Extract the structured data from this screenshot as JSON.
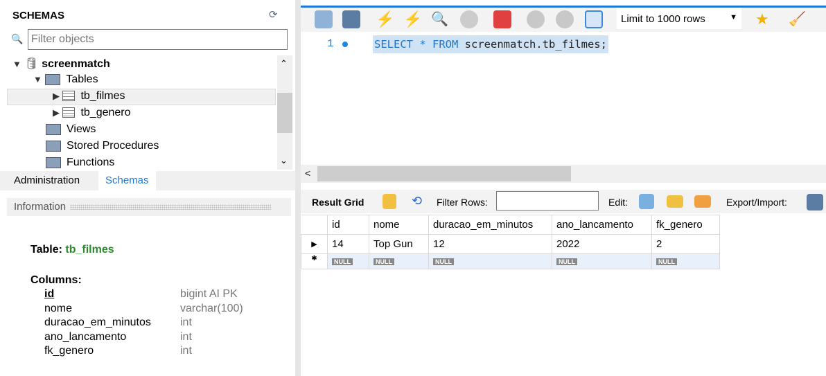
{
  "schemas": {
    "title": "SCHEMAS",
    "filter_placeholder": "Filter objects",
    "tree": {
      "schema": "screenmatch",
      "tables_label": "Tables",
      "tables": [
        "tb_filmes",
        "tb_genero"
      ],
      "views": "Views",
      "procedures": "Stored Procedures",
      "functions": "Functions"
    }
  },
  "tabs": [
    "Administration",
    "Schemas"
  ],
  "information": {
    "header": "Information",
    "table_label": "Table:",
    "table_name": "tb_filmes",
    "columns_label": "Columns:",
    "columns": [
      {
        "name": "id",
        "type": "bigint AI PK"
      },
      {
        "name": "nome",
        "type": "varchar(100)"
      },
      {
        "name": "duracao_em_minutos",
        "type": "int"
      },
      {
        "name": "ano_lancamento",
        "type": "int"
      },
      {
        "name": "fk_genero",
        "type": "int"
      }
    ]
  },
  "editor": {
    "limit": "Limit to 1000 rows",
    "line": "1",
    "sql_kw1": "SELECT",
    "sql_mid": " * ",
    "sql_kw2": "FROM",
    "sql_rest": " screenmatch.tb_filmes;"
  },
  "result": {
    "result_grid": "Result Grid",
    "filter_rows": "Filter Rows:",
    "edit": "Edit:",
    "export": "Export/Import:",
    "columns": [
      "id",
      "nome",
      "duracao_em_minutos",
      "ano_lancamento",
      "fk_genero"
    ],
    "rows": [
      [
        "14",
        "Top Gun",
        "12",
        "2022",
        "2"
      ]
    ],
    "null": "NULL"
  },
  "colors": {
    "accent": "#1e78d8",
    "table_name": "#2e8b2e",
    "selection": "#cfe3f5"
  }
}
